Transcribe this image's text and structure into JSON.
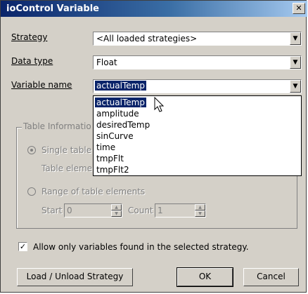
{
  "window": {
    "title": "ioControl Variable",
    "close_glyph": "✕"
  },
  "fields": {
    "strategy": {
      "label": "Strategy",
      "value": "<All loaded strategies>"
    },
    "data_type": {
      "label": "Data type",
      "value": "Float"
    },
    "variable_name": {
      "label": "Variable name",
      "value": "actualTemp"
    }
  },
  "dropdown": {
    "items": [
      "actualTemp",
      "amplitude",
      "desiredTemp",
      "sinCurve",
      "time",
      "tmpFlt",
      "tmpFlt2"
    ],
    "selected_index": 0
  },
  "table_info": {
    "title": "Table Informatio",
    "single_label": "Single table",
    "single_selected": true,
    "element_label": "Table eleme",
    "range_label": "Range of table elements",
    "start_label": "Start",
    "start_value": "0",
    "count_label": "Count",
    "count_value": "1"
  },
  "checkbox": {
    "label": "Allow only variables found in the selected strategy.",
    "checked": true
  },
  "buttons": {
    "load": "Load / Unload Strategy",
    "ok": "OK",
    "cancel": "Cancel"
  }
}
